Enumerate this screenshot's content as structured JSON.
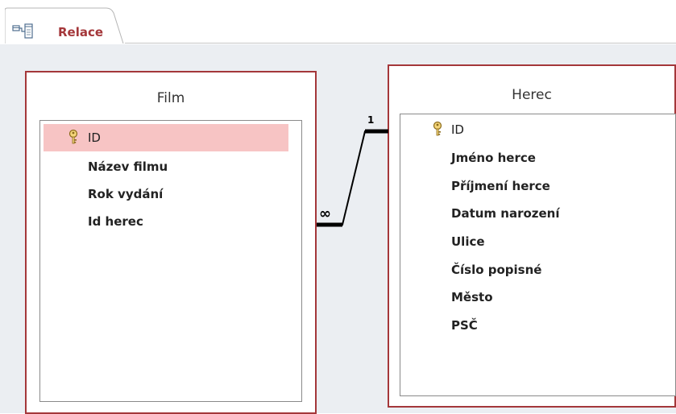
{
  "tab": {
    "label": "Relace",
    "icon": "relationships-icon"
  },
  "tables": {
    "film": {
      "title": "Film",
      "fields": [
        "ID",
        "Název filmu",
        "Rok vydání",
        "Id herec"
      ],
      "primary_key": "ID",
      "selected_field": "ID"
    },
    "herec": {
      "title": "Herec",
      "fields": [
        "ID",
        "Jméno herce",
        "Příjmení herce",
        "Datum narození",
        "Ulice",
        "Číslo popisné",
        "Město",
        "PSČ"
      ],
      "primary_key": "ID"
    }
  },
  "relationship": {
    "one_side_label": "1",
    "many_side_label": "∞",
    "from": "Herec.ID",
    "to": "Film.Id herec"
  },
  "colors": {
    "accent": "#a4373a",
    "canvas": "#ebeef2",
    "selection": "#f7c4c4"
  }
}
